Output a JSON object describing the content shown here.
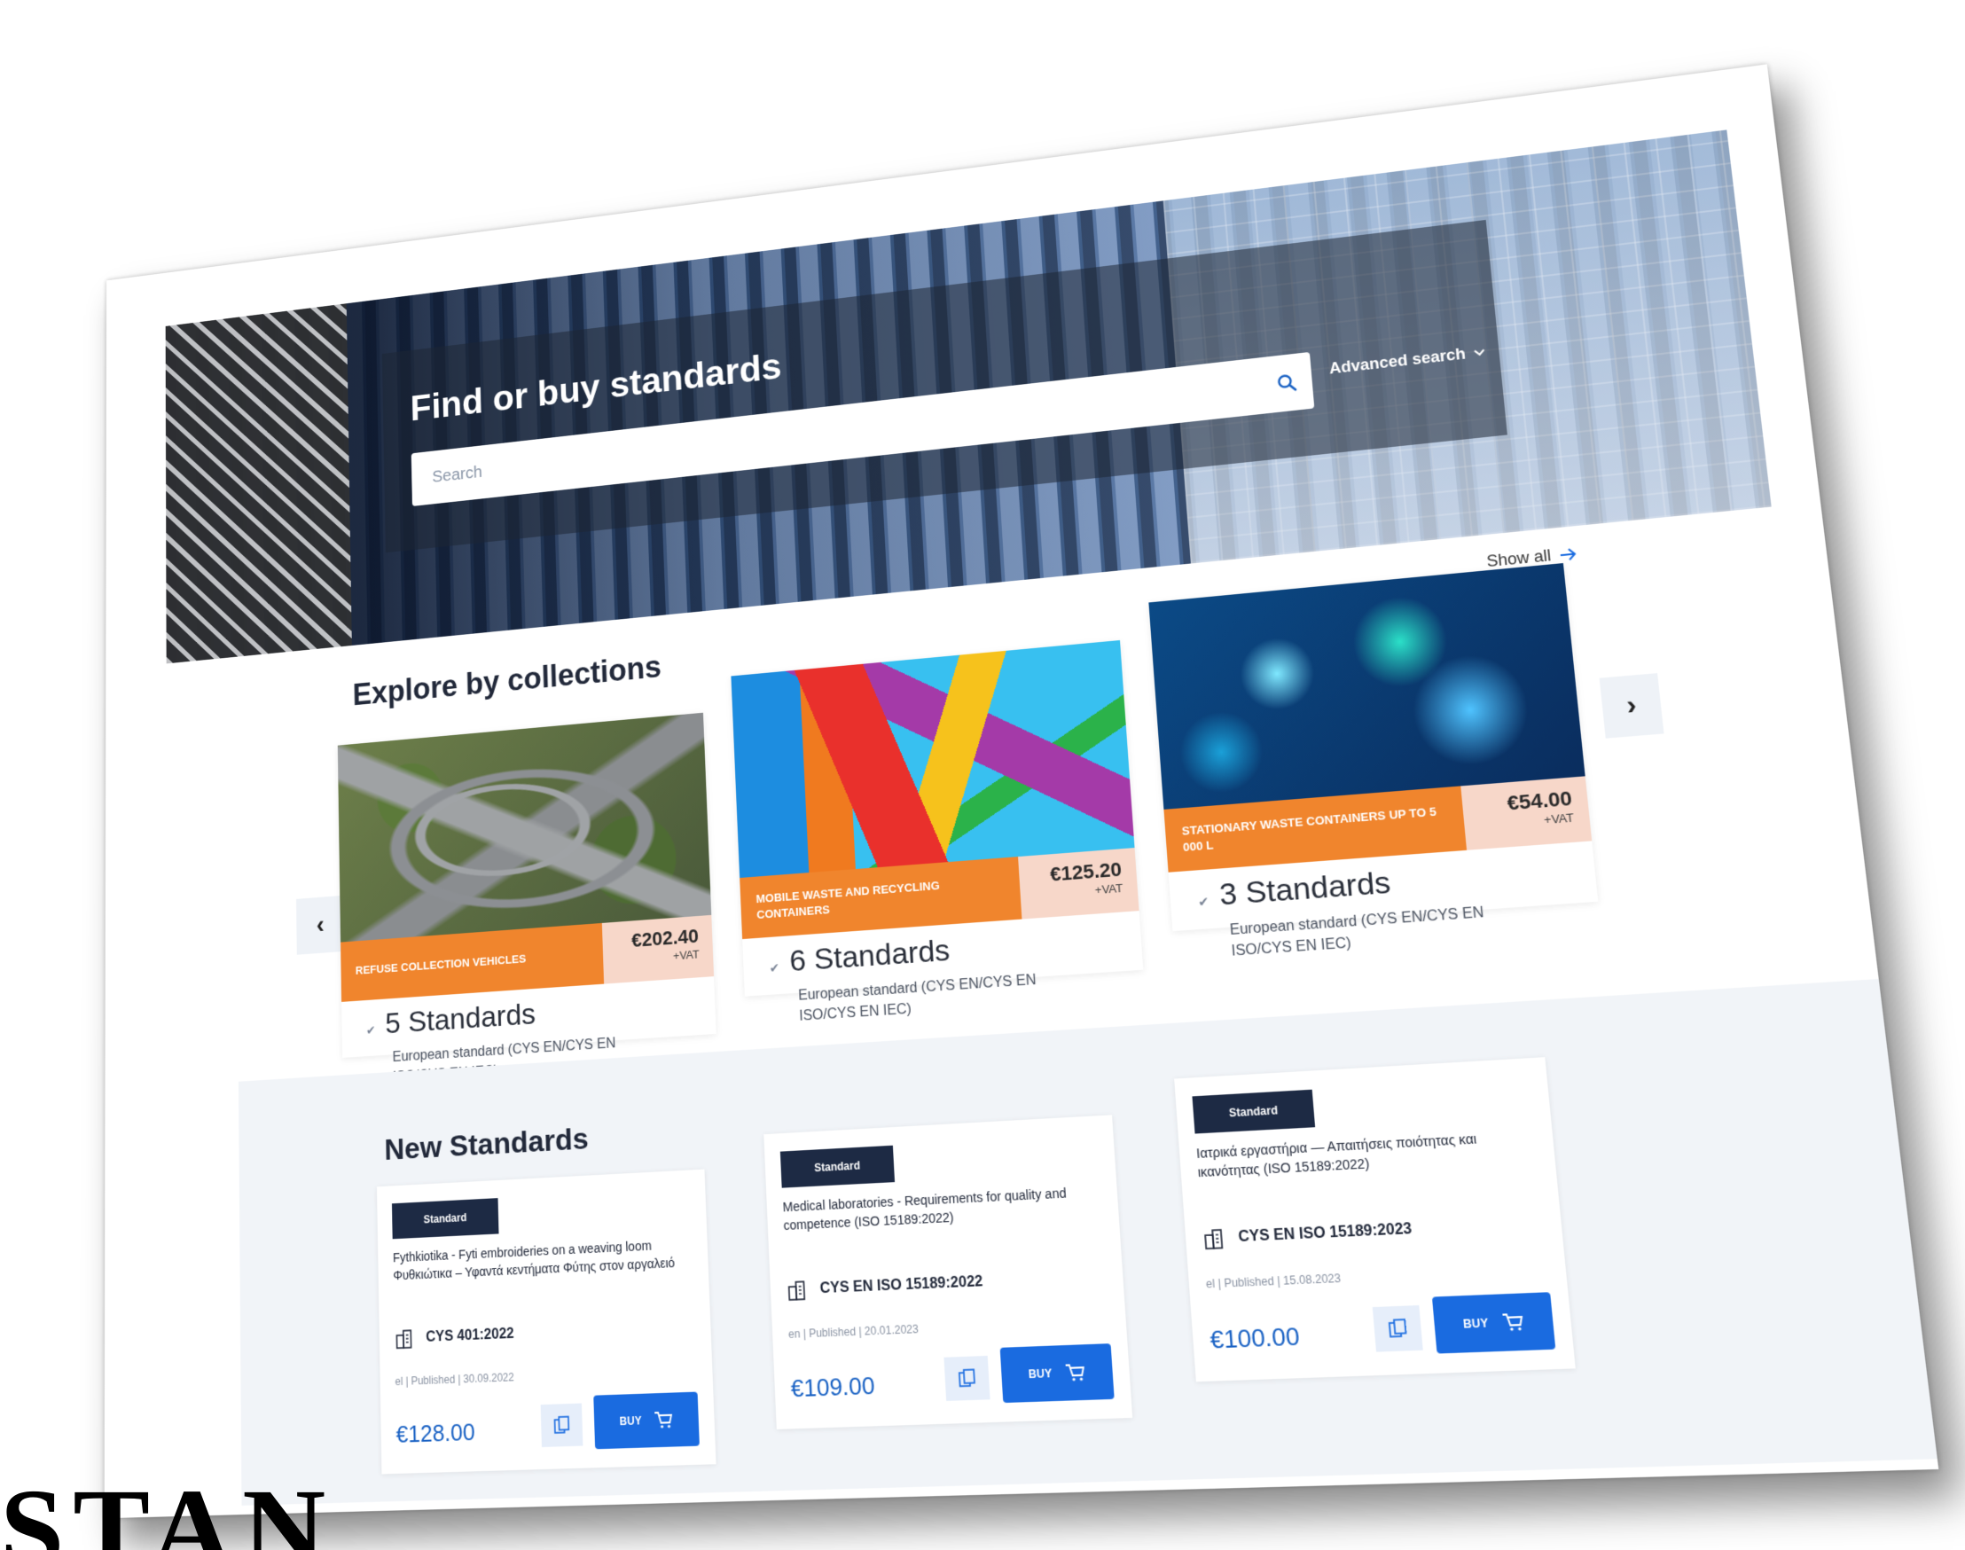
{
  "hero": {
    "title": "Find or buy standards",
    "search_placeholder": "Search",
    "advanced_search": "Advanced search",
    "icons": {
      "search": "search-icon",
      "advanced": "chevron-down-icon"
    }
  },
  "collections": {
    "title": "Explore by collections",
    "show_all": "Show all",
    "prev_arrow": "‹",
    "next_arrow": "›",
    "items": [
      {
        "label": "REFUSE COLLECTION VEHICLES",
        "price": "€202.40",
        "vat": "+VAT",
        "count": "5 Standards",
        "description": "European standard (CYS EN/CYS EN ISO/CYS EN IEC)"
      },
      {
        "label": "MOBILE WASTE AND RECYCLING CONTAINERS",
        "price": "€125.20",
        "vat": "+VAT",
        "count": "6 Standards",
        "description": "European standard (CYS EN/CYS EN ISO/CYS EN IEC)"
      },
      {
        "label": "STATIONARY WASTE CONTAINERS UP TO 5 000 L",
        "price": "€54.00",
        "vat": "+VAT",
        "count": "3 Standards",
        "description": "European standard (CYS EN/CYS EN ISO/CYS EN IEC)"
      }
    ]
  },
  "new_standards": {
    "title": "New Standards",
    "items": [
      {
        "badge": "Standard",
        "title": "Fythkiotika - Fyti embroideries on a weaving loom Φυθκιώτικα – Υφαντά κεντήματα Φύτης στον αργαλειό",
        "code": "CYS 401:2022",
        "meta": "el | Published | 30.09.2022",
        "price": "€128.00",
        "buy": "BUY"
      },
      {
        "badge": "Standard",
        "title": "Medical laboratories - Requirements for quality and competence (ISO 15189:2022)",
        "code": "CYS EN ISO 15189:2022",
        "meta": "en | Published | 20.01.2023",
        "price": "€109.00",
        "buy": "BUY"
      },
      {
        "badge": "Standard",
        "title": "Ιατρικά εργαστήρια — Απαιτήσεις ποιότητας και ικανότητας (ISO 15189:2022)",
        "code": "CYS EN ISO 15189:2023",
        "meta": "el | Published | 15.08.2023",
        "price": "€100.00",
        "buy": "BUY"
      }
    ]
  },
  "logo_fragment": "STAN",
  "colors": {
    "accent_orange": "#f0852d",
    "price_bg": "#f7d7c9",
    "buy_blue": "#1a6be0",
    "badge_navy": "#1d2a44",
    "price_text": "#1a62c4"
  }
}
